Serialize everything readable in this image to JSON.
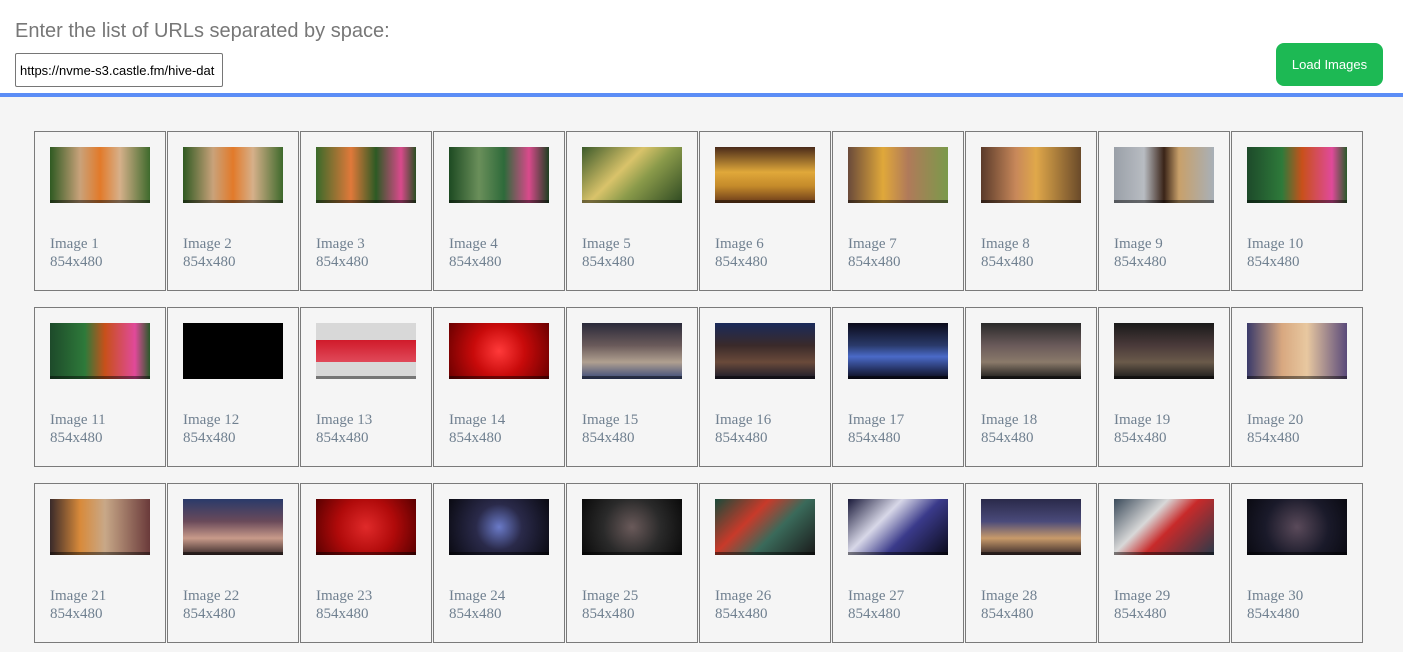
{
  "header": {
    "prompt": "Enter the list of URLs separated by space:",
    "url_value": "https://nvme-s3.castle.fm/hive-dat",
    "load_button": "Load Images",
    "accent_color": "#5b8df6",
    "button_color": "#1db954"
  },
  "images": [
    {
      "name": "Image 1",
      "size": "854x480",
      "thumb": "linear-gradient(90deg,#2f5a22 0%,#c9a27a 30%,#e27a2a 50%,#d6b08a 70%,#3e6a2c 100%)"
    },
    {
      "name": "Image 2",
      "size": "854x480",
      "thumb": "linear-gradient(90deg,#2f5a22 0%,#c9a27a 30%,#e27a2a 50%,#d6b08a 70%,#3e6a2c 100%)"
    },
    {
      "name": "Image 3",
      "size": "854x480",
      "thumb": "linear-gradient(90deg,#3a6a2a 0%,#e0793a 35%,#2d5a24 60%,#d94a8c 85%,#2b4f22 100%)"
    },
    {
      "name": "Image 4",
      "size": "854x480",
      "thumb": "linear-gradient(90deg,#1d4a22 0%,#6a8f5a 30%,#2e6a3a 55%,#d94a8c 80%,#1f3f22 100%)"
    },
    {
      "name": "Image 5",
      "size": "854x480",
      "thumb": "linear-gradient(135deg,#3b5a2a 0%,#d9c36a 40%,#8a9a4a 60%,#2f4a22 100%)"
    },
    {
      "name": "Image 6",
      "size": "854x480",
      "thumb": "linear-gradient(180deg,#4a2a1a 0%,#e0a83a 45%,#c48a2a 70%,#6a3a1a 100%)"
    },
    {
      "name": "Image 7",
      "size": "854x480",
      "thumb": "linear-gradient(90deg,#6a4a3a 0%,#e0a83a 35%,#b07a5a 60%,#7a9a4a 100%)"
    },
    {
      "name": "Image 8",
      "size": "854x480",
      "thumb": "linear-gradient(90deg,#5a3a2a 0%,#c8885a 35%,#e0a84a 55%,#6a4a2a 100%)"
    },
    {
      "name": "Image 9",
      "size": "854x480",
      "thumb": "linear-gradient(90deg,#9aa0a8 0%,#b8bcc2 30%,#3a2418 50%,#c8a06a 65%,#a8b0b8 100%)"
    },
    {
      "name": "Image 10",
      "size": "854x480",
      "thumb": "linear-gradient(90deg,#1d4a2a 0%,#2e7a3a 35%,#c8501a 55%,#e04a9a 85%,#2a5a2a 100%)"
    },
    {
      "name": "Image 11",
      "size": "854x480",
      "thumb": "linear-gradient(90deg,#1d4a2a 0%,#2e7a3a 35%,#c8501a 55%,#e04a9a 85%,#2a5a2a 100%)"
    },
    {
      "name": "Image 12",
      "size": "854x480",
      "thumb": "#000000"
    },
    {
      "name": "Image 13",
      "size": "854x480",
      "thumb": "linear-gradient(180deg,#d8d8d8 0%,#d8d8d8 30%,#d01a2a 30%,#e04a5a 70%,#d8d8d8 70%,#d8d8d8 100%)"
    },
    {
      "name": "Image 14",
      "size": "854x480",
      "thumb": "radial-gradient(circle at 50% 50%,#ff3a3a 0%,#c80a0a 45%,#6a0000 100%)"
    },
    {
      "name": "Image 15",
      "size": "854x480",
      "thumb": "linear-gradient(180deg,#2a2a3a 0%,#6a5a5a 40%,#b0a090 70%,#3a4a7a 100%)"
    },
    {
      "name": "Image 16",
      "size": "854x480",
      "thumb": "linear-gradient(180deg,#1a2a5a 0%,#3a2a2a 40%,#6a4a3a 70%,#1a1a2a 100%)"
    },
    {
      "name": "Image 17",
      "size": "854x480",
      "thumb": "linear-gradient(180deg,#0a0a1a 0%,#2a3a6a 40%,#4a6ac8 60%,#0a0a1a 100%)"
    },
    {
      "name": "Image 18",
      "size": "854x480",
      "thumb": "linear-gradient(180deg,#2a2a2a 0%,#6a5a5a 40%,#8a7a6a 70%,#1a1a1a 100%)"
    },
    {
      "name": "Image 19",
      "size": "854x480",
      "thumb": "linear-gradient(180deg,#1a1a1a 0%,#4a3a3a 40%,#6a5a4a 70%,#1a1a1a 100%)"
    },
    {
      "name": "Image 20",
      "size": "854x480",
      "thumb": "linear-gradient(90deg,#3a3a6a 0%,#d8a880 35%,#e8c8a0 60%,#5a4a7a 100%)"
    },
    {
      "name": "Image 21",
      "size": "854x480",
      "thumb": "linear-gradient(90deg,#3a2a2a 0%,#d88a3a 30%,#c8a888 55%,#6a3a3a 100%)"
    },
    {
      "name": "Image 22",
      "size": "854x480",
      "thumb": "linear-gradient(180deg,#2a3a6a 0%,#6a4a5a 40%,#c89a8a 70%,#3a2a2a 100%)"
    },
    {
      "name": "Image 23",
      "size": "854x480",
      "thumb": "radial-gradient(circle at 50% 50%,#e02a2a 0%,#b00a0a 50%,#5a0000 100%)"
    },
    {
      "name": "Image 24",
      "size": "854x480",
      "thumb": "radial-gradient(circle at 50% 50%,#6a7ac8 0%,#2a2a4a 40%,#0a0a12 100%)"
    },
    {
      "name": "Image 25",
      "size": "854x480",
      "thumb": "radial-gradient(circle at 50% 50%,#6a5a5a 0%,#2a2a2a 50%,#0a0a0a 100%)"
    },
    {
      "name": "Image 26",
      "size": "854x480",
      "thumb": "linear-gradient(135deg,#1a4a3a 0%,#c83a2a 35%,#3a6a5a 60%,#1a1a1a 100%)"
    },
    {
      "name": "Image 27",
      "size": "854x480",
      "thumb": "linear-gradient(135deg,#1a1a3a 0%,#d8d8e8 35%,#3a3a8a 60%,#0a0a1a 100%)"
    },
    {
      "name": "Image 28",
      "size": "854x480",
      "thumb": "linear-gradient(180deg,#2a2a4a 0%,#4a4a7a 40%,#c89a6a 70%,#3a2a2a 100%)"
    },
    {
      "name": "Image 29",
      "size": "854x480",
      "thumb": "linear-gradient(135deg,#3a4a5a 0%,#d8d8d8 35%,#c82a2a 55%,#2a3a4a 100%)"
    },
    {
      "name": "Image 30",
      "size": "854x480",
      "thumb": "radial-gradient(circle at 50% 50%,#5a4a5a 0%,#1a1a2a 55%,#0a0a12 100%)"
    }
  ]
}
